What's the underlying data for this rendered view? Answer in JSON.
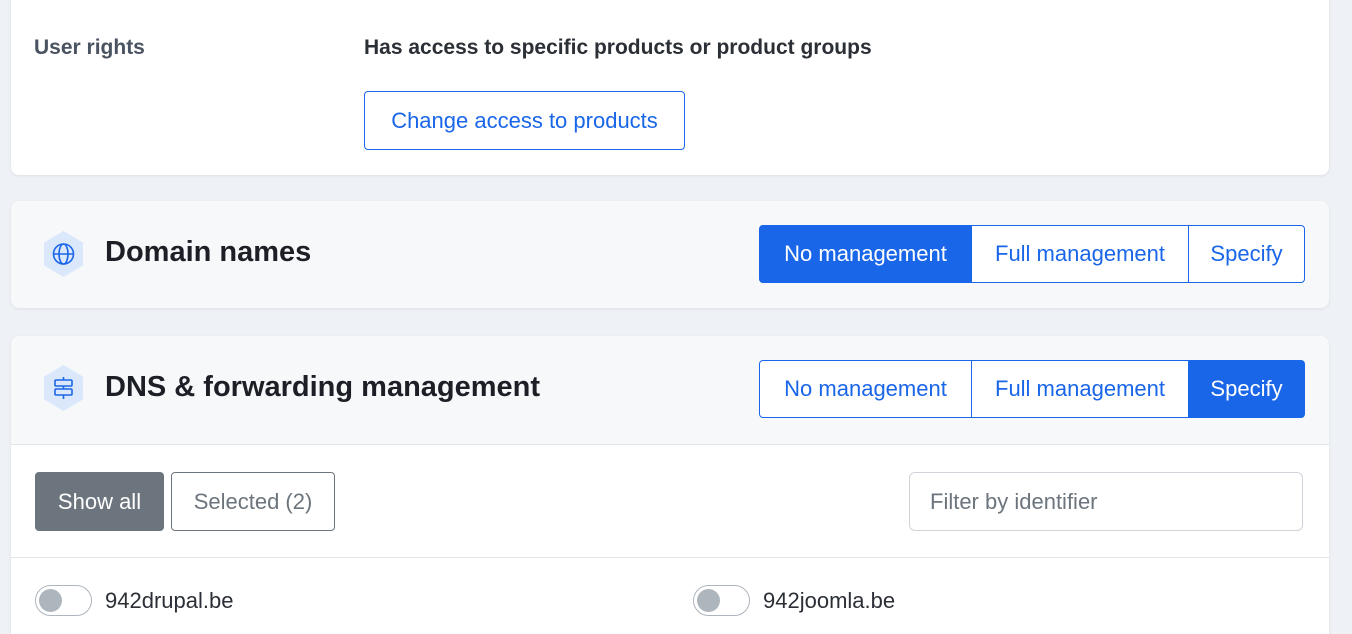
{
  "user_rights": {
    "label": "User rights",
    "value": "Has access to specific products or product groups",
    "change_button": "Change access to products"
  },
  "sections": [
    {
      "title": "Domain names",
      "icon": "globe-icon",
      "options": [
        "No management",
        "Full management",
        "Specify"
      ],
      "selected": "No management"
    },
    {
      "title": "DNS & forwarding management",
      "icon": "signpost-icon",
      "options": [
        "No management",
        "Full management",
        "Specify"
      ],
      "selected": "Specify"
    }
  ],
  "dns_filter": {
    "show_all": "Show all",
    "selected": "Selected (2)",
    "active_tab": "Show all",
    "search_placeholder": "Filter by identifier"
  },
  "domains": [
    {
      "name": "942drupal.be",
      "enabled": false
    },
    {
      "name": "942joomla.be",
      "enabled": false
    }
  ],
  "colors": {
    "accent": "#1a66e8",
    "secondary": "#6c757d",
    "icon_bg": "#dbe8fb",
    "background": "#eef1f5"
  }
}
